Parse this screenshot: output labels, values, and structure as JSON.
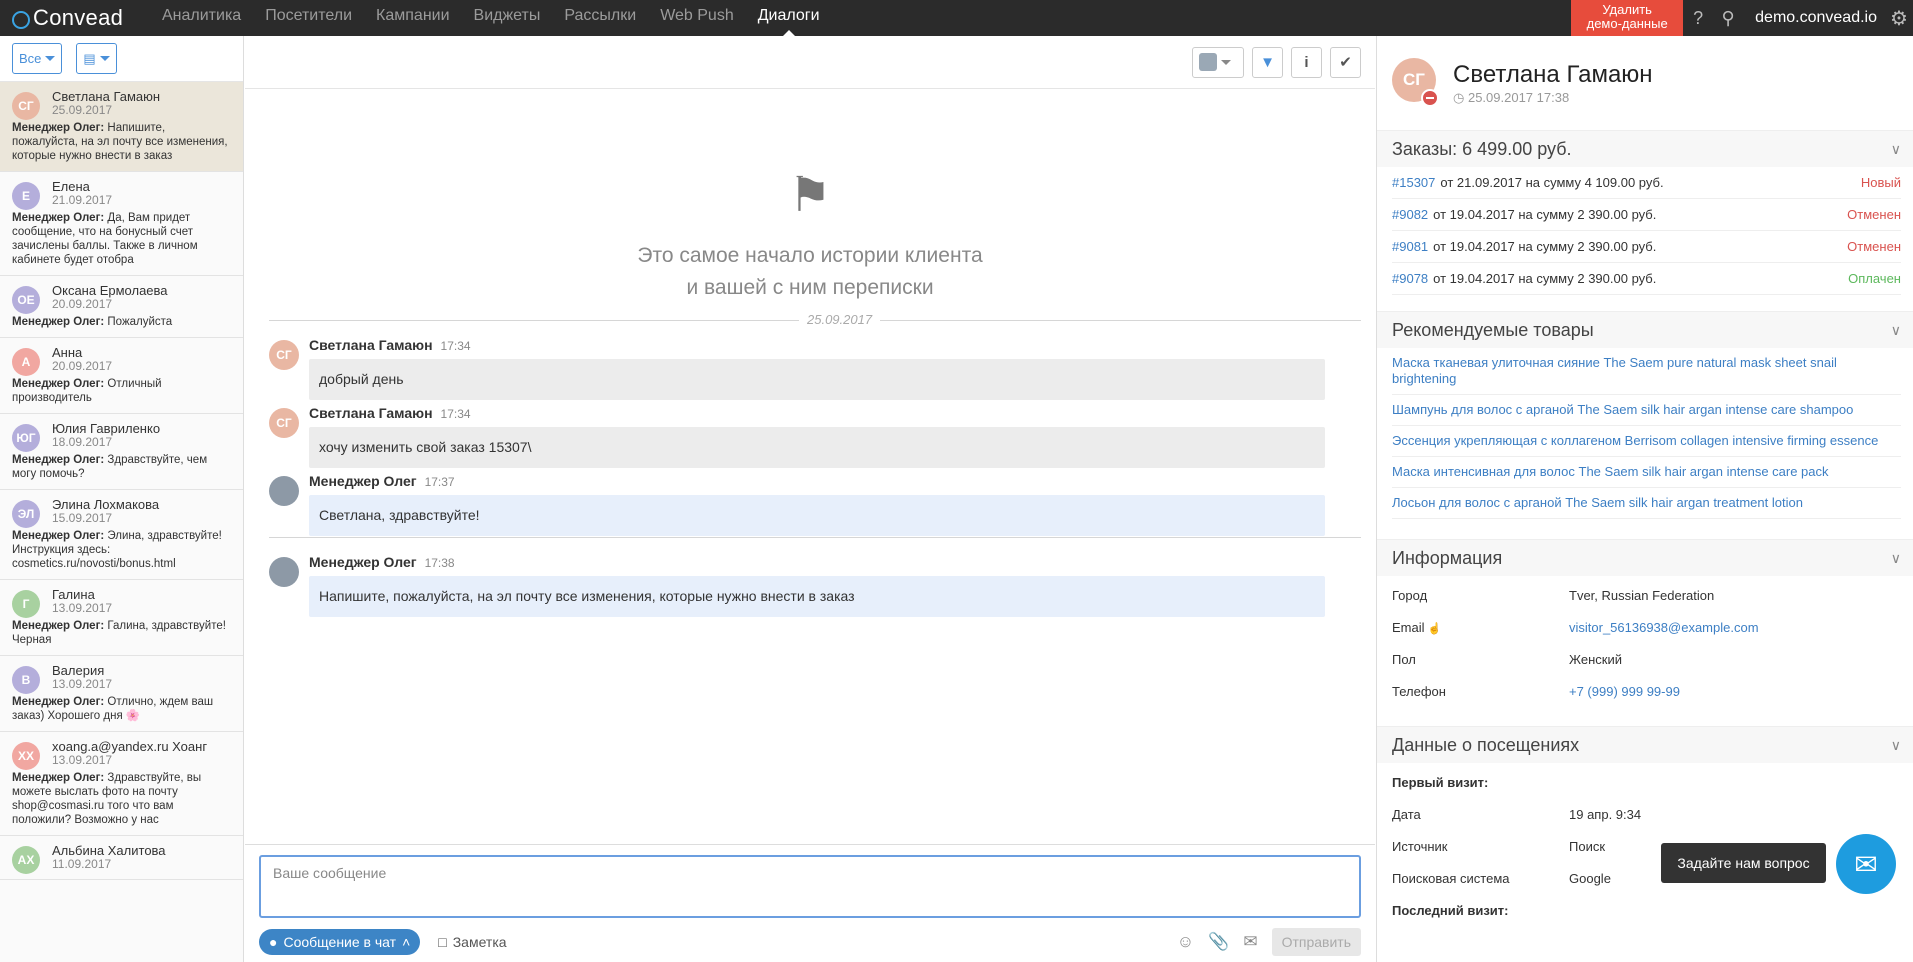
{
  "brand": {
    "name": "Convead"
  },
  "nav": [
    "Аналитика",
    "Посетители",
    "Кампании",
    "Виджеты",
    "Рассылки",
    "Web Push",
    "Диалоги"
  ],
  "nav_active": "Диалоги",
  "topright": {
    "delete_demo_l1": "Удалить",
    "delete_demo_l2": "демо-данные",
    "site": "demo.convead.io"
  },
  "sidebar": {
    "filter_label": "Все",
    "conversations": [
      {
        "initials": "СГ",
        "name": "Светлана Гамаюн",
        "date": "25.09.2017",
        "sender": "Менеджер Олег:",
        "text": "Напишите, пожалуйста, на эл почту все изменения, которые нужно внести в заказ",
        "color": "#e9b7a3",
        "selected": true
      },
      {
        "initials": "Е",
        "name": "Елена",
        "date": "21.09.2017",
        "sender": "Менеджер Олег:",
        "text": "Да, Вам придет сообщение, что на бонусный счет зачислены баллы. Также в личном кабинете будет отобра",
        "color": "#b4aedb"
      },
      {
        "initials": "ОЕ",
        "name": "Оксана Ермолаева",
        "date": "20.09.2017",
        "sender": "Менеджер Олег:",
        "text": "Пожалуйста",
        "color": "#b4aedb"
      },
      {
        "initials": "А",
        "name": "Анна",
        "date": "20.09.2017",
        "sender": "Менеджер Олег:",
        "text": "Отличный производитель",
        "color": "#f1a7a1"
      },
      {
        "initials": "ЮГ",
        "name": "Юлия Гавриленко",
        "date": "18.09.2017",
        "sender": "Менеджер Олег:",
        "text": "Здравствуйте, чем могу помочь?",
        "color": "#b4aedb"
      },
      {
        "initials": "ЭЛ",
        "name": "Элина Лохмакова",
        "date": "15.09.2017",
        "sender": "Менеджер Олег:",
        "text": "Элина, здравствуйте! Инструкция здесь: cosmetics.ru/novosti/bonus.html",
        "color": "#b4aedb"
      },
      {
        "initials": "Г",
        "name": "Галина",
        "date": "13.09.2017",
        "sender": "Менеджер Олег:",
        "text": "Галина, здравствуйте! Черная",
        "color": "#a8d1a0"
      },
      {
        "initials": "В",
        "name": "Валерия",
        "date": "13.09.2017",
        "sender": "Менеджер Олег:",
        "text": "Отлично, ждем ваш заказ) Хорошего дня 🌸",
        "color": "#b4aedb"
      },
      {
        "initials": "ХХ",
        "name": "xoang.a@yandex.ru Хоанг",
        "date": "13.09.2017",
        "sender": "Менеджер Олег:",
        "text": "Здравствуйте, вы можете выслать фото на почту shop@cosmasi.ru того что вам положили? Возможно у нас",
        "color": "#f1a7a1"
      },
      {
        "initials": "АХ",
        "name": "Альбина Халитова",
        "date": "11.09.2017",
        "sender": "",
        "text": "",
        "color": "#a8d1a0"
      }
    ]
  },
  "main": {
    "history_l1": "Это самое начало истории клиента",
    "history_l2": "и вашей с ним переписки",
    "date_divider": "25.09.2017",
    "messages": [
      {
        "author": "Светлана Гамаюн",
        "time": "17:34",
        "text": "добрый день",
        "type": "client",
        "initials": "СГ"
      },
      {
        "author": "Светлана Гамаюн",
        "time": "17:34",
        "text": "хочу изменить свой заказ 15307\\",
        "type": "client",
        "initials": "СГ"
      },
      {
        "author": "Менеджер Олег",
        "time": "17:37",
        "text": "Светлана, здравствуйте!",
        "type": "manager",
        "initials": ""
      },
      {
        "author": "Менеджер Олег",
        "time": "17:38",
        "text": "Напишите, пожалуйста, на эл почту все изменения, которые нужно внести в заказ",
        "type": "manager",
        "initials": ""
      }
    ],
    "composer": {
      "placeholder": "Ваше сообщение",
      "chat_button": "Сообщение в чат",
      "note": "Заметка",
      "send": "Отправить"
    }
  },
  "right": {
    "profile": {
      "initials": "СГ",
      "name": "Светлана Гамаюн",
      "time": "25.09.2017 17:38"
    },
    "orders_title": "Заказы: 6 499.00 руб.",
    "orders": [
      {
        "id": "#15307",
        "text": "от 21.09.2017 на сумму 4 109.00 руб.",
        "status": "Новый",
        "status_color": "#d9534f"
      },
      {
        "id": "#9082",
        "text": "от 19.04.2017 на сумму 2 390.00 руб.",
        "status": "Отменен",
        "status_color": "#d9534f"
      },
      {
        "id": "#9081",
        "text": "от 19.04.2017 на сумму 2 390.00 руб.",
        "status": "Отменен",
        "status_color": "#d9534f"
      },
      {
        "id": "#9078",
        "text": "от 19.04.2017 на сумму 2 390.00 руб.",
        "status": "Оплачен",
        "status_color": "#5cb85c"
      }
    ],
    "rec_title": "Рекомендуемые товары",
    "products": [
      "Маска тканевая улиточная сияние The Saem pure natural mask sheet snail brightening",
      "Шампунь для волос с арганой The Saem silk hair argan intense care shampoo",
      "Эссенция укрепляющая с коллагеном Berrisom collagen intensive firming essence",
      "Маска интенсивная для волос The Saem silk hair argan intense care pack",
      "Лосьон для волос с арганой The Saem silk hair argan treatment lotion"
    ],
    "info_title": "Информация",
    "info": [
      {
        "k": "Город",
        "v": "Tver, Russian Federation",
        "link": false
      },
      {
        "k": "Email",
        "v": "visitor_56136938@example.com",
        "link": true
      },
      {
        "k": "Пол",
        "v": "Женский",
        "link": false
      },
      {
        "k": "Телефон",
        "v": "+7 (999) 999 99-99",
        "link": true
      }
    ],
    "visits_title": "Данные о посещениях",
    "first_visit": "Первый визит:",
    "visit_rows": [
      {
        "k": "Дата",
        "v": "19 апр. 9:34"
      },
      {
        "k": "Источник",
        "v": "Поиск"
      },
      {
        "k": "Поисковая система",
        "v": "Google"
      }
    ],
    "last_visit": "Последний визит:"
  },
  "help": {
    "chip": "Задайте нам вопрос"
  }
}
